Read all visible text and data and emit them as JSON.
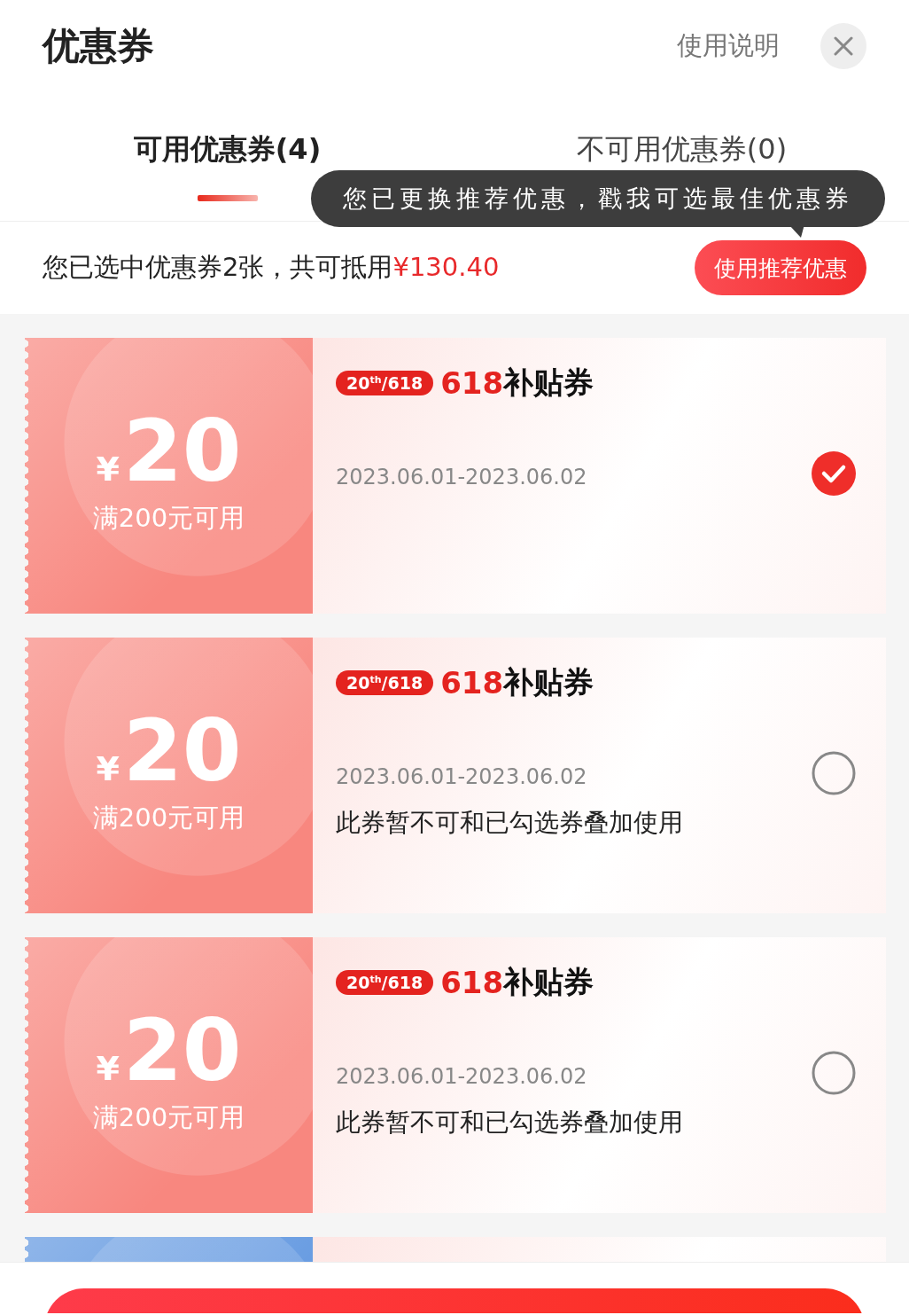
{
  "header": {
    "title": "优惠券",
    "help_link": "使用说明"
  },
  "tabs": [
    {
      "label": "可用优惠券(4)",
      "selected": true
    },
    {
      "label": "不可用优惠券(0)",
      "selected": false
    }
  ],
  "tooltip": {
    "text": "您已更换推荐优惠，戳我可选最佳优惠券"
  },
  "summary": {
    "text": "您已选中优惠券2张，共可抵用",
    "amount": "¥130.40",
    "button": "使用推荐优惠"
  },
  "coupons": [
    {
      "color": "#f8877f",
      "currency": "¥",
      "amount": "20",
      "condition": "满200元可用",
      "badge": "20$^{th}$/618",
      "brand": "618",
      "title": "补贴券",
      "date": "2023.06.01-2023.06.02",
      "selected": true
    },
    {
      "color": "#f8877f",
      "currency": "¥",
      "amount": "20",
      "condition": "满200元可用",
      "badge": "20$^{th}$/618",
      "brand": "618",
      "title": "补贴券",
      "date": "2023.06.01-2023.06.02",
      "note": "此券暂不可和已勾选券叠加使用",
      "selected": false
    },
    {
      "color": "#f8877f",
      "currency": "¥",
      "amount": "20",
      "condition": "满200元可用",
      "badge": "20$^{th}$/618",
      "brand": "618",
      "title": "补贴券",
      "date": "2023.06.01-2023.06.02",
      "note": "此券暂不可和已勾选券叠加使用",
      "selected": false
    },
    {
      "color": "#5f96e0"
    }
  ]
}
